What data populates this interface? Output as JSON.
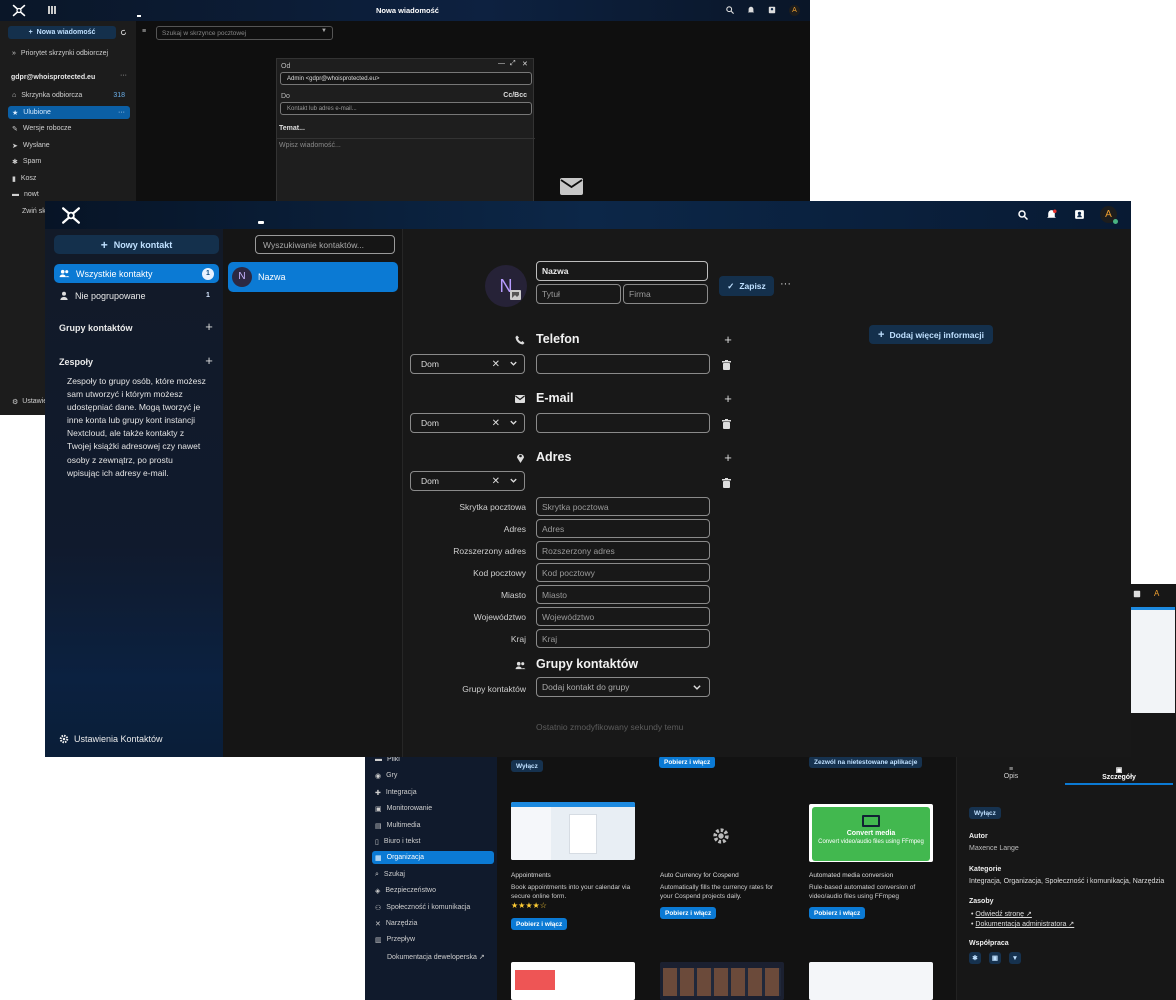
{
  "mail": {
    "topbar": {
      "title": "Nowa wiadomość"
    },
    "new_message": "Nowa wiadomość",
    "priority_inbox": "Priorytet skrzynki odbiorczej",
    "account": "gdpr@whoisprotected.eu",
    "search_placeholder": "Szukaj w skrzynce pocztowej",
    "folders": [
      {
        "label": "Skrzynka odbiorcza",
        "count": "318"
      },
      {
        "label": "Ulubione",
        "count": ""
      },
      {
        "label": "Wersje robocze",
        "count": ""
      },
      {
        "label": "Wysłane",
        "count": ""
      },
      {
        "label": "Spam",
        "count": ""
      },
      {
        "label": "Kosz",
        "count": ""
      },
      {
        "label": "nowt",
        "count": ""
      }
    ],
    "collapse_label": "Zwiń sk",
    "settings_label": "Ustawie",
    "compose": {
      "from_label": "Od",
      "from_value": "Admin <gdpr@whoisprotected.eu>",
      "to_label": "Do",
      "ccbcc": "Cc/Bcc",
      "to_placeholder": "Kontakt lub adres e-mail...",
      "subject_placeholder": "Temat...",
      "body_placeholder": "Wpisz wiadomość..."
    }
  },
  "apps": {
    "categories": [
      "Pliki",
      "Gry",
      "Integracja",
      "Monitorowanie",
      "Multimedia",
      "Biuro i tekst",
      "Organizacja",
      "Szukaj",
      "Bezpieczeństwo",
      "Społeczność i komunikacja",
      "Narzędzia",
      "Przepływ",
      "Dokumentacja deweloperska ↗"
    ],
    "active_category": "Organizacja",
    "top_buttons": {
      "disable": "Wyłącz",
      "download": "Pobierz i włącz",
      "allow_untested": "Zezwól na nietestowane aplikacje"
    },
    "cards": [
      {
        "name": "Appointments",
        "desc": "Book appointments into your calendar via secure online form.",
        "stars": "★★★★☆",
        "button": "Pobierz i włącz"
      },
      {
        "name": "Auto Currency for Cospend",
        "desc": "Automatically fills the currency rates for your Cospend projects daily.",
        "button": "Pobierz i włącz"
      },
      {
        "name": "Automated media conversion",
        "desc": "Rule-based automated conversion of video/audio files using FFmpeg",
        "button": "Pobierz i włącz",
        "thumb_title": "Convert media",
        "thumb_sub": "Convert video/audio files using FFmpeg"
      }
    ],
    "detail": {
      "tab_desc": "Opis",
      "tab_details": "Szczegóły",
      "disable": "Wyłącz",
      "author_label": "Autor",
      "author": "Maxence Lange",
      "categories_label": "Kategorie",
      "categories": "Integracja, Organizacja, Społeczność i komunikacja, Narzędzia",
      "resources_label": "Zasoby",
      "resources": [
        "Odwiedź stronę ↗",
        "Dokumentacja administratora ↗"
      ],
      "collab_label": "Współpraca"
    }
  },
  "contacts": {
    "new_contact": "Nowy kontakt",
    "nav": [
      {
        "label": "Wszystkie kontakty",
        "count": "1"
      },
      {
        "label": "Nie pogrupowane",
        "count": "1"
      }
    ],
    "groups_title": "Grupy kontaktów",
    "teams_title": "Zespoły",
    "teams_text": "Zespoły to grupy osób, które możesz sam utworzyć i którym możesz udostępniać dane. Mogą tworzyć je inne konta lub grupy kont instancji Nextcloud, ale także kontakty z Twojej książki adresowej czy nawet osoby z zewnątrz, po prostu wpisując ich adresy e-mail.",
    "settings": "Ustawienia Kontaktów",
    "search_placeholder": "Wyszukiwanie kontaktów...",
    "list": [
      {
        "initial": "N",
        "name": "Nazwa"
      }
    ],
    "detail": {
      "avatar_initial": "N",
      "name_value": "Nazwa",
      "title_placeholder": "Tytuł",
      "company_placeholder": "Firma",
      "save": "Zapisz",
      "add_more": "Dodaj więcej informacji",
      "phone_title": "Telefon",
      "email_title": "E-mail",
      "address_title": "Adres",
      "type_value": "Dom",
      "address_fields": [
        {
          "label": "Skrytka pocztowa",
          "placeholder": "Skrytka pocztowa"
        },
        {
          "label": "Adres",
          "placeholder": "Adres"
        },
        {
          "label": "Rozszerzony adres",
          "placeholder": "Rozszerzony adres"
        },
        {
          "label": "Kod pocztowy",
          "placeholder": "Kod pocztowy"
        },
        {
          "label": "Miasto",
          "placeholder": "Miasto"
        },
        {
          "label": "Województwo",
          "placeholder": "Województwo"
        },
        {
          "label": "Kraj",
          "placeholder": "Kraj"
        }
      ],
      "groups_title": "Grupy kontaktów",
      "groups_label": "Grupy kontaktów",
      "groups_placeholder": "Dodaj kontakt do grupy",
      "modified": "Ostatnio zmodyfikowany sekundy temu"
    }
  },
  "user_initial": "A",
  "colors": {
    "accent": "#0b7ad4",
    "topbar": "#0c2748",
    "bg": "#181818"
  }
}
